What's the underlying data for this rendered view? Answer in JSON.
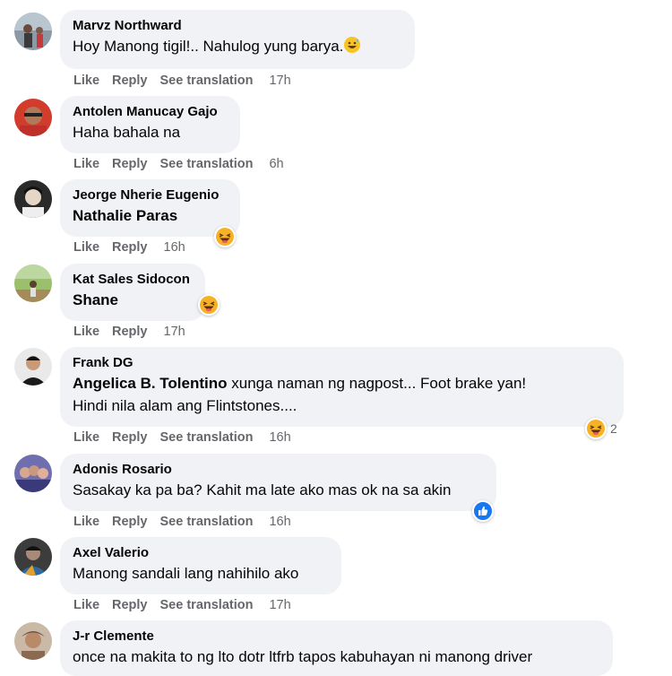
{
  "actions": {
    "like": "Like",
    "reply": "Reply",
    "see_translation": "See translation"
  },
  "comments": [
    {
      "author": "Marvz Northward",
      "text": "Hoy Manong tigil!.. Nahulog yung barya.",
      "time": "17h",
      "inline_emoji": "grinning-sweat-icon"
    },
    {
      "author": "Antolen Manucay Gajo",
      "text": "Haha bahala na",
      "time": "6h"
    },
    {
      "author": "Jeorge Nherie Eugenio",
      "tag": "Nathalie Paras",
      "time": "16h",
      "reaction": "haha-reaction-icon"
    },
    {
      "author": "Kat Sales Sidocon",
      "tag": "Shane",
      "time": "17h",
      "reaction": "haha-reaction-icon"
    },
    {
      "author": "Frank DG",
      "tag": "Angelica B. Tolentino",
      "text_line1": " xunga naman ng nagpost... Foot brake yan!",
      "text_line2": "Hindi nila alam ang Flintstones....",
      "time": "16h",
      "reaction": "haha-reaction-icon",
      "reaction_count": "2"
    },
    {
      "author": "Adonis Rosario",
      "text": "Sasakay ka pa ba? Kahit ma late ako mas ok na sa akin",
      "time": "16h",
      "reaction": "like-reaction-icon"
    },
    {
      "author": "Axel Valerio",
      "text": "Manong sandali lang nahihilo ako",
      "time": "17h"
    },
    {
      "author": "J-r Clemente",
      "text": "once na makita to ng lto dotr ltfrb tapos kabuhayan ni manong driver"
    }
  ],
  "colors": {
    "bubble": "#f0f2f5",
    "action_text": "#65676b",
    "like_blue": "#1877f2",
    "haha_yellow": "#f7b125"
  }
}
